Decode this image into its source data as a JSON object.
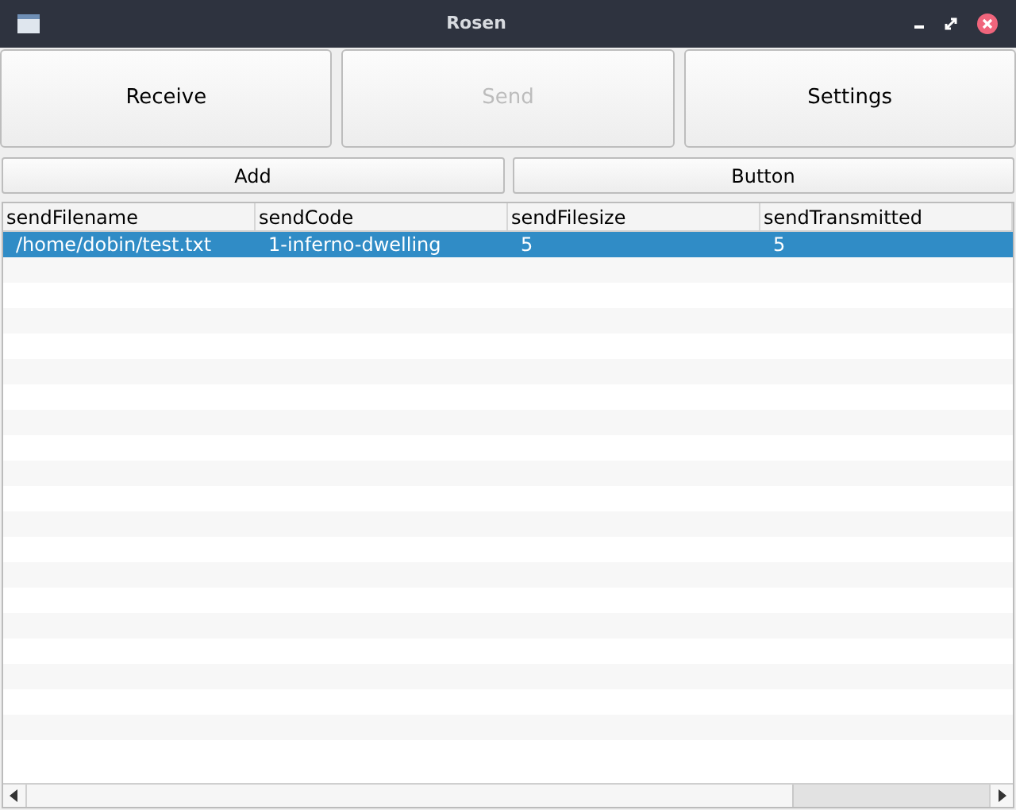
{
  "window": {
    "title": "Rosen"
  },
  "top_buttons": [
    {
      "label": "Receive",
      "disabled": false
    },
    {
      "label": "Send",
      "disabled": true
    },
    {
      "label": "Settings",
      "disabled": false
    }
  ],
  "action_buttons": [
    "Add",
    "Button"
  ],
  "table": {
    "columns": [
      "sendFilename",
      "sendCode",
      "sendFilesize",
      "sendTransmitted"
    ],
    "rows": [
      {
        "cells": [
          "/home/dobin/test.txt",
          "1-inferno-dwelling",
          "5",
          "5"
        ],
        "selected": true
      }
    ]
  }
}
